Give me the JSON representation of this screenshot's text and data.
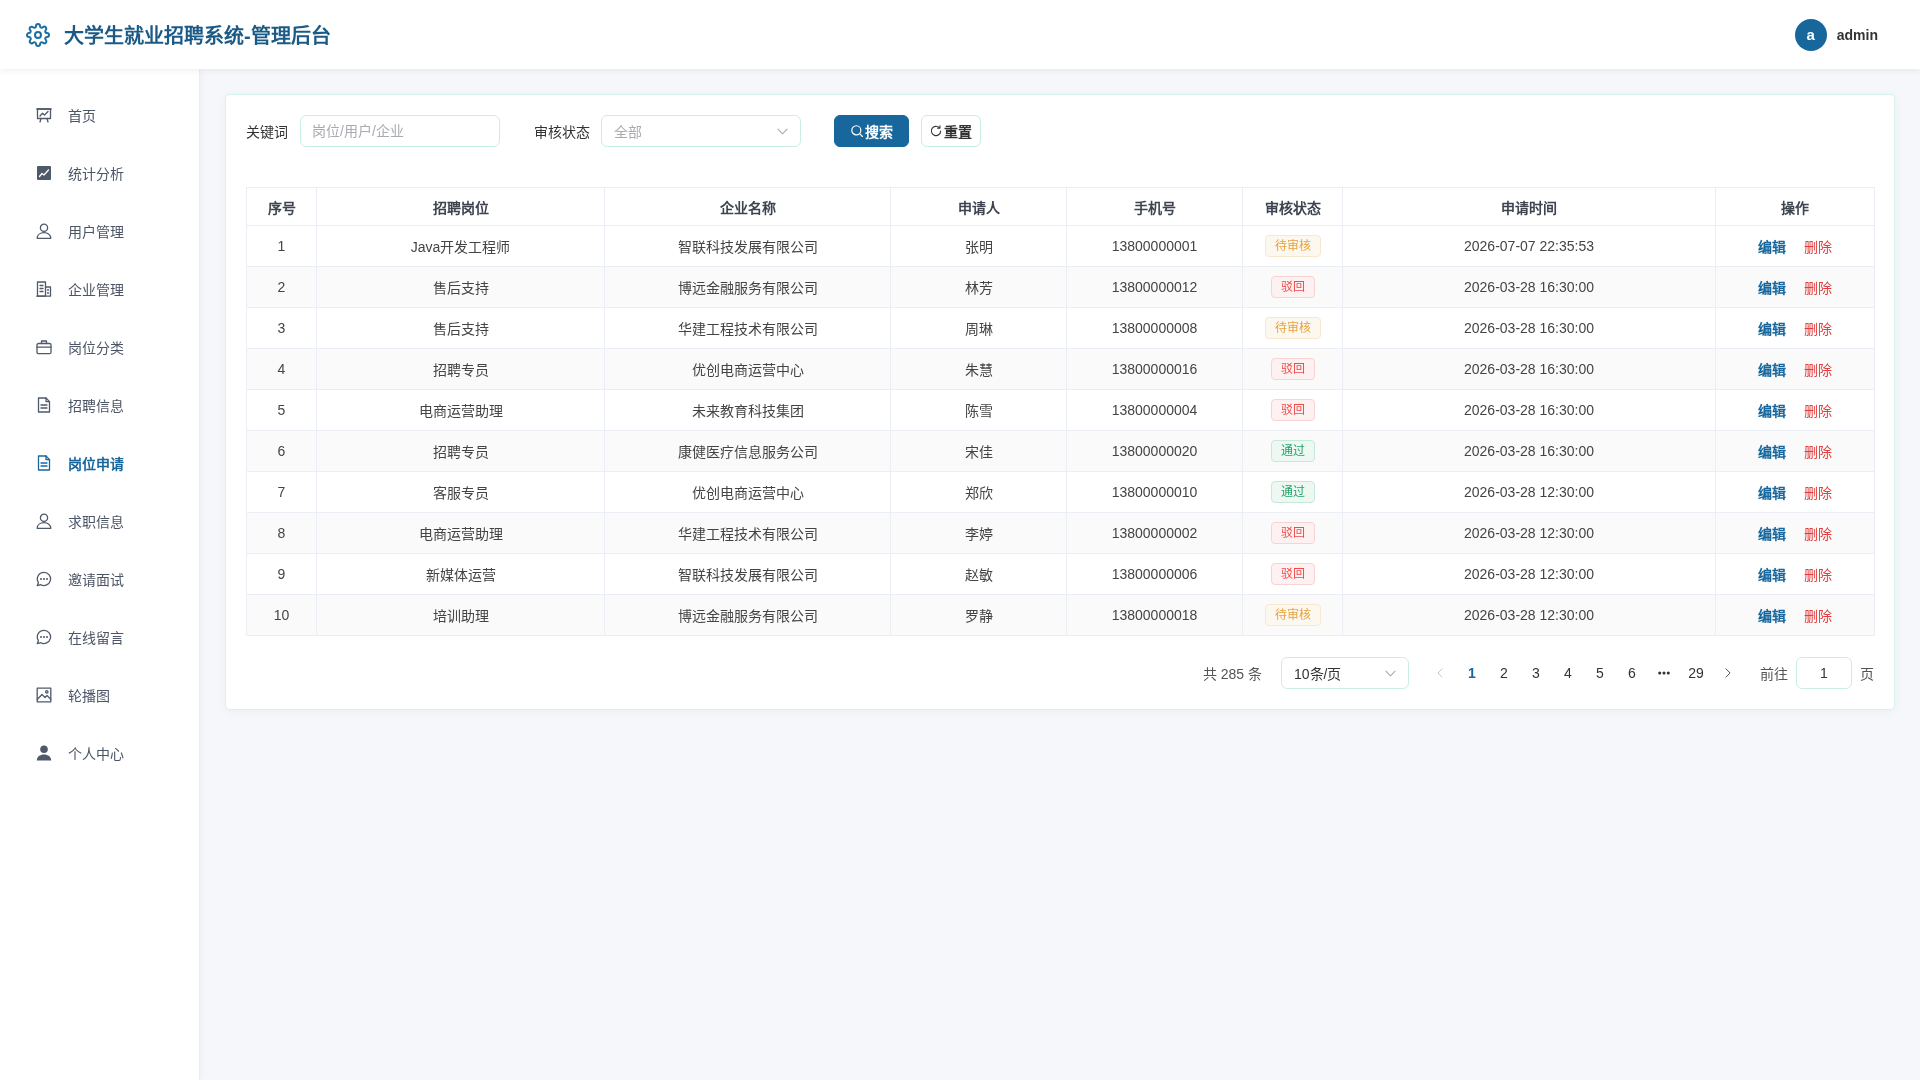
{
  "header": {
    "title": "大学生就业招聘系统-管理后台",
    "avatar_letter": "a",
    "username": "admin"
  },
  "sidebar": {
    "items": [
      {
        "label": "首页",
        "selected": false
      },
      {
        "label": "统计分析",
        "selected": false
      },
      {
        "label": "用户管理",
        "selected": false
      },
      {
        "label": "企业管理",
        "selected": false
      },
      {
        "label": "岗位分类",
        "selected": false
      },
      {
        "label": "招聘信息",
        "selected": false
      },
      {
        "label": "岗位申请",
        "selected": true
      },
      {
        "label": "求职信息",
        "selected": false
      },
      {
        "label": "邀请面试",
        "selected": false
      },
      {
        "label": "在线留言",
        "selected": false
      },
      {
        "label": "轮播图",
        "selected": false
      },
      {
        "label": "个人中心",
        "selected": false
      }
    ]
  },
  "filters": {
    "keyword": {
      "label": "关键词",
      "placeholder": "岗位/用户/企业"
    },
    "status": {
      "label": "审核状态",
      "placeholder": "全部"
    },
    "buttons": [
      {
        "label": "搜索",
        "kind": "search"
      },
      {
        "label": "重置",
        "kind": "reset"
      }
    ]
  },
  "table": {
    "columns": [
      "序号",
      "招聘岗位",
      "企业名称",
      "申请人",
      "手机号",
      "审核状态",
      "申请时间",
      "操作"
    ],
    "rows": [
      {
        "index": "1",
        "position": "Java开发工程师",
        "company": "智联科技发展有限公司",
        "applicant": "张明",
        "phone": "13800000001",
        "status": {
          "label": "待审核",
          "color": "#e6a23c"
        },
        "time": "2026-07-07 22:35:53",
        "actions": [
          {
            "label": "编辑",
            "kind": "edit"
          },
          {
            "label": "删除",
            "kind": "delete"
          }
        ]
      },
      {
        "index": "2",
        "position": "售后支持",
        "company": "博远金融服务有限公司",
        "applicant": "林芳",
        "phone": "13800000012",
        "status": {
          "label": "驳回",
          "color": "#ee4b4b"
        },
        "time": "2026-03-28 16:30:00",
        "actions": [
          {
            "label": "编辑",
            "kind": "edit"
          },
          {
            "label": "删除",
            "kind": "delete"
          }
        ]
      },
      {
        "index": "3",
        "position": "售后支持",
        "company": "华建工程技术有限公司",
        "applicant": "周琳",
        "phone": "13800000008",
        "status": {
          "label": "待审核",
          "color": "#e6a23c"
        },
        "time": "2026-03-28 16:30:00",
        "actions": [
          {
            "label": "编辑",
            "kind": "edit"
          },
          {
            "label": "删除",
            "kind": "delete"
          }
        ]
      },
      {
        "index": "4",
        "position": "招聘专员",
        "company": "优创电商运营中心",
        "applicant": "朱慧",
        "phone": "13800000016",
        "status": {
          "label": "驳回",
          "color": "#ee4b4b"
        },
        "time": "2026-03-28 16:30:00",
        "actions": [
          {
            "label": "编辑",
            "kind": "edit"
          },
          {
            "label": "删除",
            "kind": "delete"
          }
        ]
      },
      {
        "index": "5",
        "position": "电商运营助理",
        "company": "未来教育科技集团",
        "applicant": "陈雪",
        "phone": "13800000004",
        "status": {
          "label": "驳回",
          "color": "#ee4b4b"
        },
        "time": "2026-03-28 16:30:00",
        "actions": [
          {
            "label": "编辑",
            "kind": "edit"
          },
          {
            "label": "删除",
            "kind": "delete"
          }
        ]
      },
      {
        "index": "6",
        "position": "招聘专员",
        "company": "康健医疗信息服务公司",
        "applicant": "宋佳",
        "phone": "13800000020",
        "status": {
          "label": "通过",
          "color": "#22a366"
        },
        "time": "2026-03-28 16:30:00",
        "actions": [
          {
            "label": "编辑",
            "kind": "edit"
          },
          {
            "label": "删除",
            "kind": "delete"
          }
        ]
      },
      {
        "index": "7",
        "position": "客服专员",
        "company": "优创电商运营中心",
        "applicant": "郑欣",
        "phone": "13800000010",
        "status": {
          "label": "通过",
          "color": "#22a366"
        },
        "time": "2026-03-28 12:30:00",
        "actions": [
          {
            "label": "编辑",
            "kind": "edit"
          },
          {
            "label": "删除",
            "kind": "delete"
          }
        ]
      },
      {
        "index": "8",
        "position": "电商运营助理",
        "company": "华建工程技术有限公司",
        "applicant": "李婷",
        "phone": "13800000002",
        "status": {
          "label": "驳回",
          "color": "#ee4b4b"
        },
        "time": "2026-03-28 12:30:00",
        "actions": [
          {
            "label": "编辑",
            "kind": "edit"
          },
          {
            "label": "删除",
            "kind": "delete"
          }
        ]
      },
      {
        "index": "9",
        "position": "新媒体运营",
        "company": "智联科技发展有限公司",
        "applicant": "赵敏",
        "phone": "13800000006",
        "status": {
          "label": "驳回",
          "color": "#ee4b4b"
        },
        "time": "2026-03-28 12:30:00",
        "actions": [
          {
            "label": "编辑",
            "kind": "edit"
          },
          {
            "label": "删除",
            "kind": "delete"
          }
        ]
      },
      {
        "index": "10",
        "position": "培训助理",
        "company": "博远金融服务有限公司",
        "applicant": "罗静",
        "phone": "13800000018",
        "status": {
          "label": "待审核",
          "color": "#e6a23c"
        },
        "time": "2026-03-28 12:30:00",
        "actions": [
          {
            "label": "编辑",
            "kind": "edit"
          },
          {
            "label": "删除",
            "kind": "delete"
          }
        ]
      }
    ]
  },
  "pagination": {
    "total": "共 285 条",
    "page_size": "10条/页",
    "prev": {
      "disabled": true
    },
    "pages": [
      {
        "label": "1",
        "selected": true
      },
      {
        "label": "2",
        "selected": false
      },
      {
        "label": "3",
        "selected": false
      },
      {
        "label": "4",
        "selected": false
      },
      {
        "label": "5",
        "selected": false
      },
      {
        "label": "6",
        "selected": false
      },
      {
        "label": "29",
        "selected": false
      }
    ],
    "ellipsis_before_last": true,
    "next": {
      "disabled": false
    },
    "jump": {
      "label": "前往",
      "value": "1",
      "suffix": "页"
    }
  }
}
